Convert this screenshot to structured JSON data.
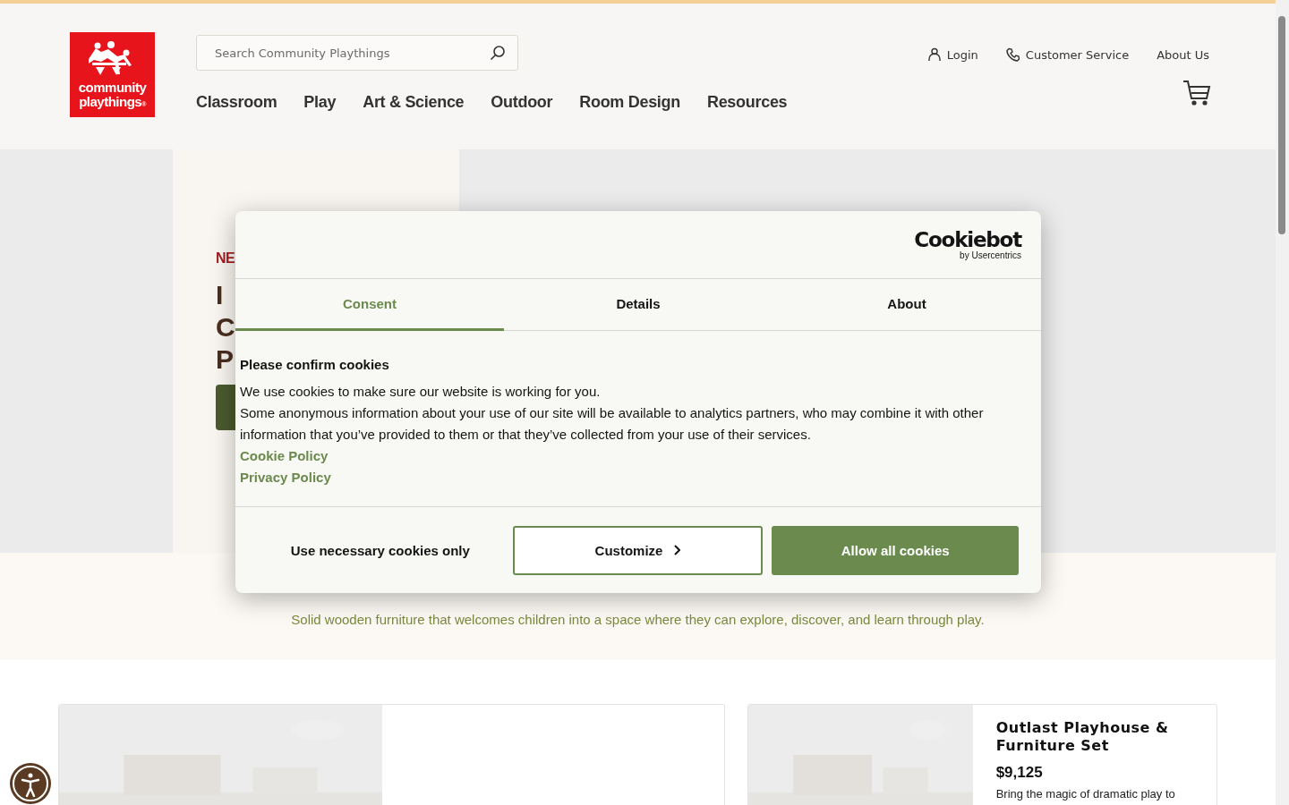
{
  "header": {
    "logo": {
      "line1": "community",
      "line2": "playthings",
      "mark": "®"
    },
    "search": {
      "placeholder": "Search Community Playthings"
    },
    "utility_links": [
      {
        "label": "Login",
        "kind": "account"
      },
      {
        "label": "Customer Service",
        "kind": "contact"
      },
      {
        "label": "About Us",
        "kind": "text"
      }
    ],
    "nav": [
      {
        "label": "Classroom"
      },
      {
        "label": "Play"
      },
      {
        "label": "Art & Science"
      },
      {
        "label": "Outdoor"
      },
      {
        "label": "Room Design"
      },
      {
        "label": "Resources"
      }
    ]
  },
  "hero": {
    "badge": "NE",
    "heading_lines": [
      "I",
      "C",
      "P"
    ]
  },
  "intro": {
    "subtitle": "Solid wooden furniture that welcomes children into a space where they can explore, discover, and learn through play."
  },
  "products": [
    {
      "kind": "picture"
    },
    {
      "kind": "picture",
      "title": "Outlast Playhouse & Furniture Set",
      "price": "$9,125",
      "description": "Bring the magic of dramatic play to"
    }
  ],
  "cookie_dialog": {
    "brand": "Cookiebot",
    "brand_sub": "by Usercentrics",
    "tabs": [
      {
        "label": "Consent",
        "selected": true
      },
      {
        "label": "Details",
        "selected": false
      },
      {
        "label": "About",
        "selected": false
      }
    ],
    "title": "Please confirm cookies",
    "paragraphs": [
      "We use cookies to make sure our website is working for you.",
      "Some anonymous information about your use of our site will be available to analytics partners, who may combine it with other information that you’ve provided to them or that they’ve collected from your use of their services."
    ],
    "links": [
      "Cookie Policy",
      "Privacy Policy"
    ],
    "buttons": [
      {
        "label": "Use necessary cookies only",
        "kind": "plain"
      },
      {
        "label": "Customize",
        "kind": "outline"
      },
      {
        "label": "Allow all cookies",
        "kind": "primary"
      }
    ]
  }
}
